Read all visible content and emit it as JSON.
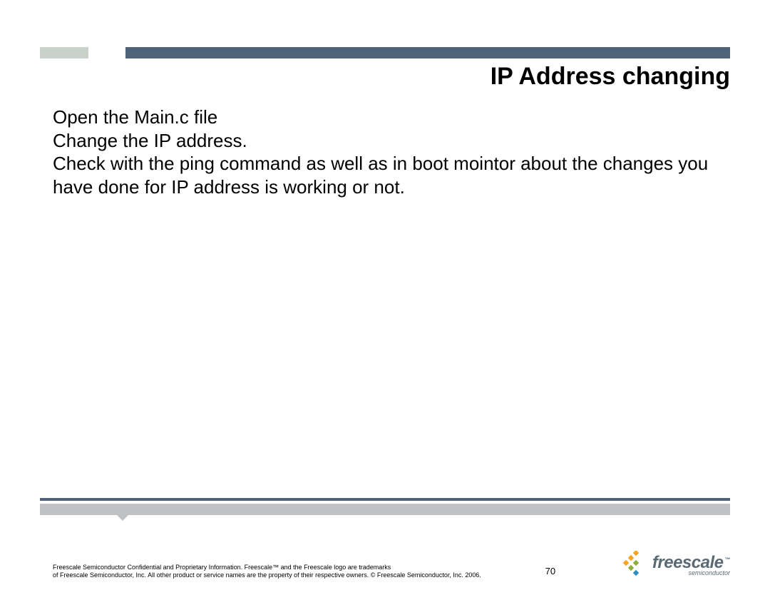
{
  "colors": {
    "header_bar_dark": "#4e6278",
    "header_bar_light": "#c9d2ca",
    "footer_bar_light": "#bfc1c5",
    "logo_text": "#5a6a74",
    "logo_orange": "#f7a51e",
    "logo_green": "#8fb13b",
    "logo_blue": "#2f8fbd"
  },
  "slide": {
    "title": "IP Address changing",
    "body_lines": [
      "Open the Main.c file",
      "Change the IP address.",
      "Check with the ping command as well as in boot mointor about the changes you have done for IP address is working or not."
    ]
  },
  "footer": {
    "legal_line1": "Freescale Semiconductor Confidential and Proprietary Information. Freescale™ and the Freescale logo are trademarks",
    "legal_line2": "of Freescale Semiconductor, Inc. All other product or service names are the property of their respective owners. © Freescale Semiconductor, Inc. 2006.",
    "page_number": "70"
  },
  "logo": {
    "name": "freescale",
    "tm": "™",
    "subtitle": "semiconductor"
  }
}
